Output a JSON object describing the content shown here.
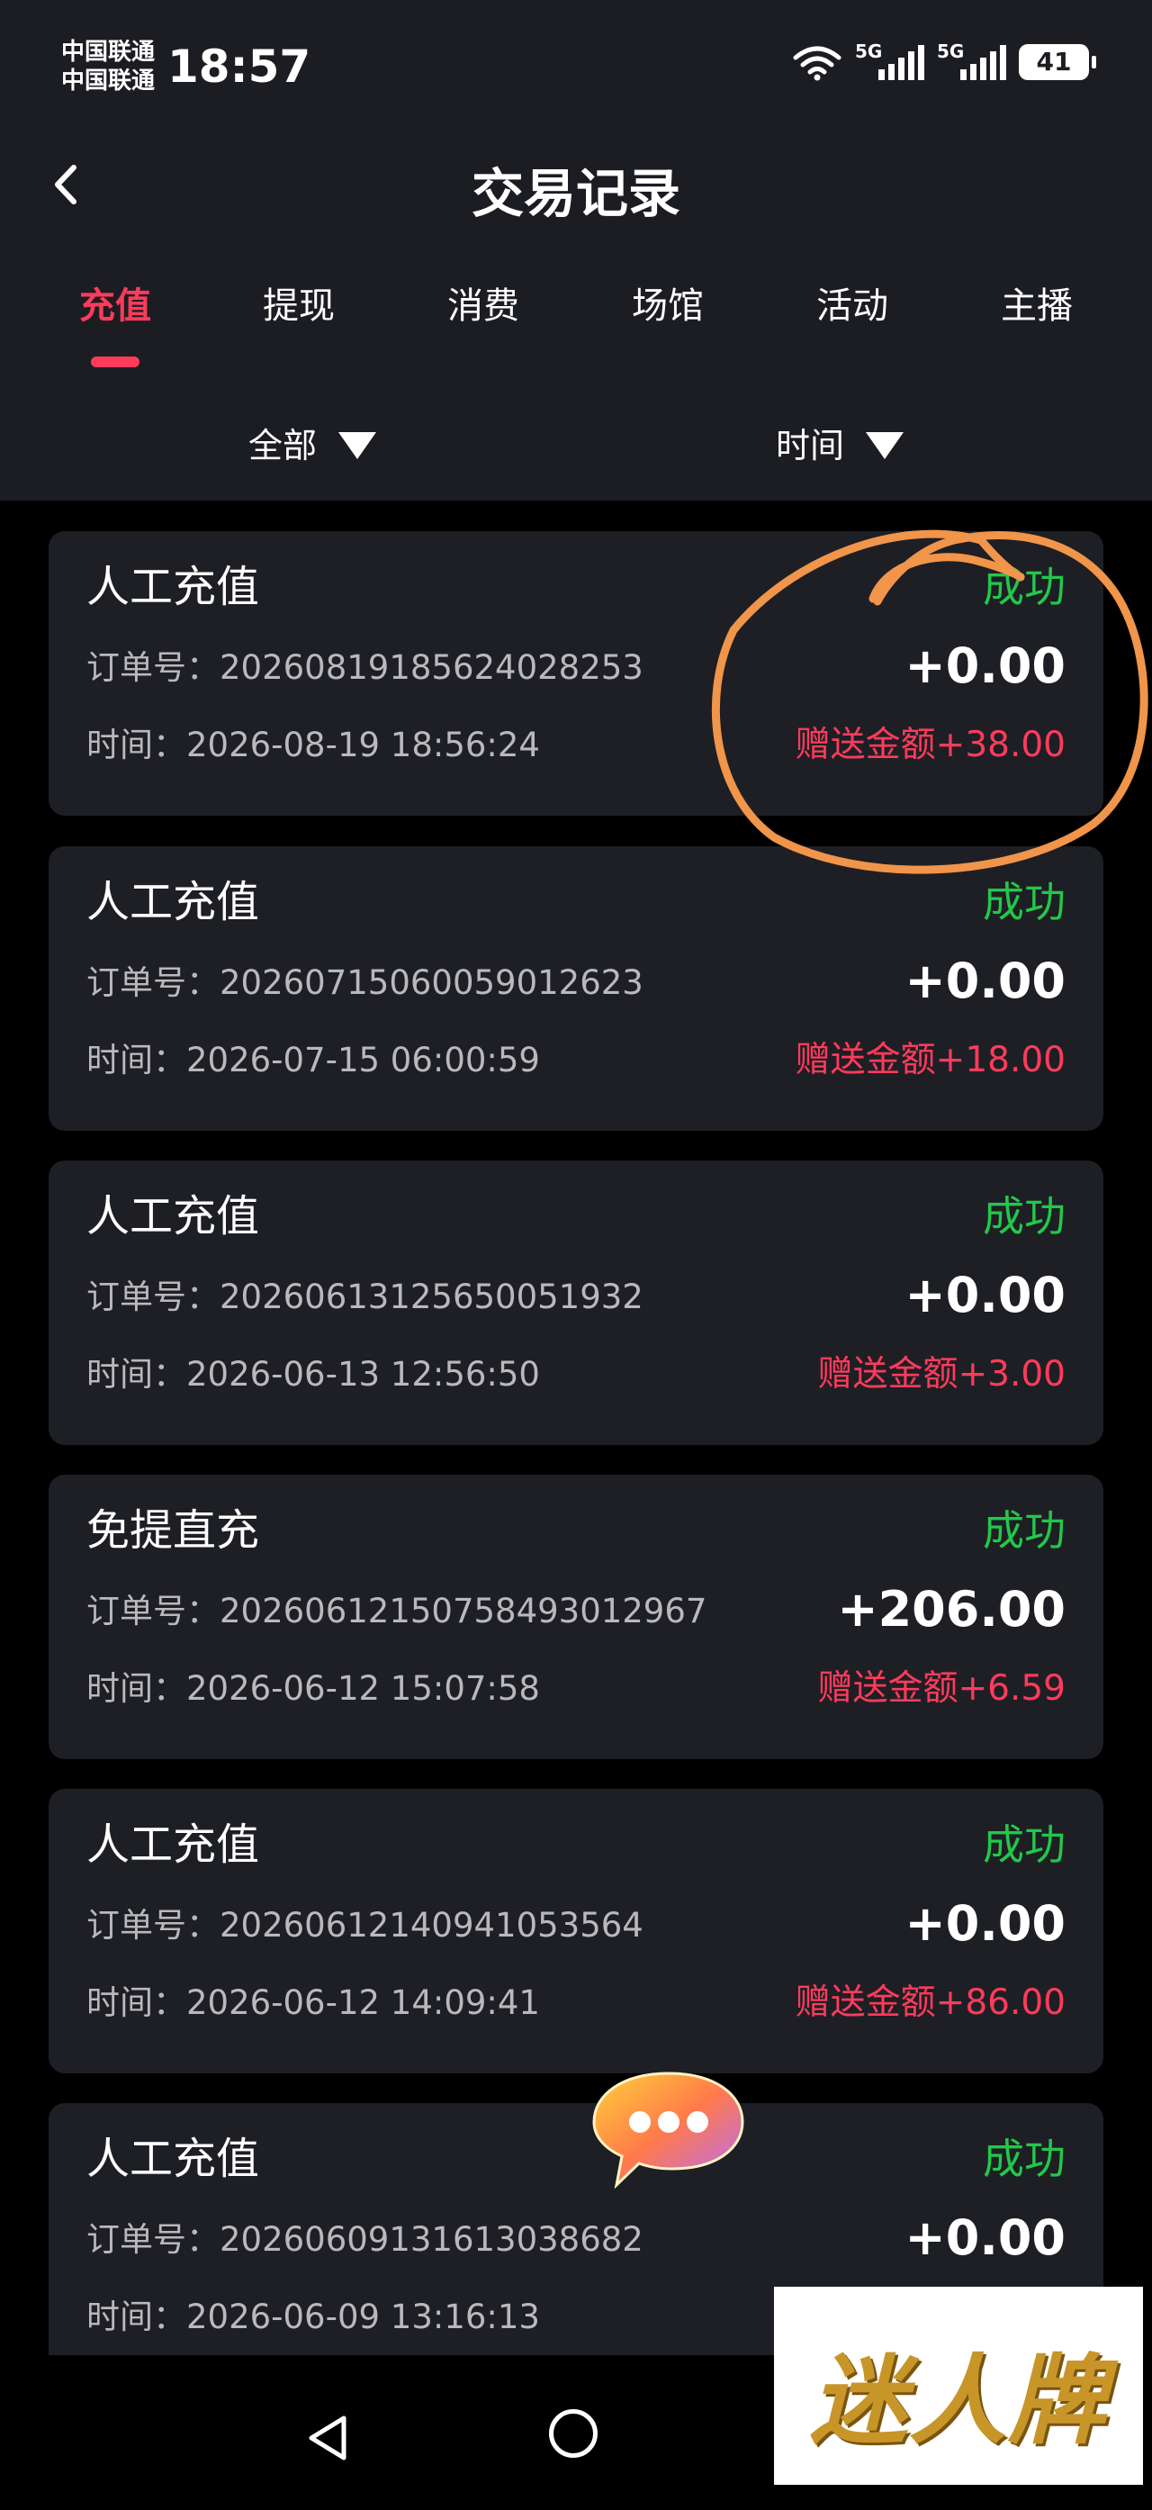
{
  "status_bar": {
    "carrier_1": "中国联通",
    "carrier_2": "中国联通",
    "time": "18:57",
    "network_1": "5G",
    "network_2": "5G",
    "battery": "41"
  },
  "header": {
    "title": "交易记录",
    "back_icon": "chevron-left-icon"
  },
  "tabs": [
    {
      "label": "充值",
      "active": true
    },
    {
      "label": "提现",
      "active": false
    },
    {
      "label": "消费",
      "active": false
    },
    {
      "label": "场馆",
      "active": false
    },
    {
      "label": "活动",
      "active": false
    },
    {
      "label": "主播",
      "active": false
    }
  ],
  "filters": {
    "type_label": "全部",
    "time_label": "时间"
  },
  "records": [
    {
      "title": "人工充值",
      "status": "成功",
      "order": "订单号：20260819185624028253",
      "amount": "+0.00",
      "time": "时间：2026-08-19 18:56:24",
      "bonus": "赠送金额+38.00"
    },
    {
      "title": "人工充值",
      "status": "成功",
      "order": "订单号：20260715060059012623",
      "amount": "+0.00",
      "time": "时间：2026-07-15 06:00:59",
      "bonus": "赠送金额+18.00"
    },
    {
      "title": "人工充值",
      "status": "成功",
      "order": "订单号：20260613125650051932",
      "amount": "+0.00",
      "time": "时间：2026-06-13 12:56:50",
      "bonus": "赠送金额+3.00"
    },
    {
      "title": "免提直充",
      "status": "成功",
      "order": "订单号：202606121507584930129​67",
      "amount": "+206.00",
      "time": "时间：2026-06-12 15:07:58",
      "bonus": "赠送金额+6.59"
    },
    {
      "title": "人工充值",
      "status": "成功",
      "order": "订单号：20260612140941053564",
      "amount": "+0.00",
      "time": "时间：2026-06-12 14:09:41",
      "bonus": "赠送金额+86.00"
    },
    {
      "title": "人工充值",
      "status": "成功",
      "order": "订单号：20260609131613038682",
      "amount": "+0.00",
      "time": "时间：2026-06-09 13:16:13",
      "bonus": ""
    }
  ],
  "watermark": {
    "text": "迷人牌"
  },
  "colors": {
    "accent": "#ff3b5c",
    "success": "#22c84a",
    "card_bg": "#1e1f24",
    "header_bg": "#1c1d22",
    "annotation": "#f0954a"
  }
}
